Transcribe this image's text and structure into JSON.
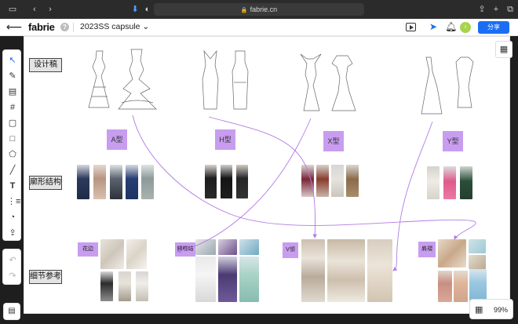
{
  "browser": {
    "url": "fabrie.cn"
  },
  "header": {
    "logo": "fabrie",
    "help": "?",
    "project_name": "2023SS capsule",
    "project_chevron": "⌄",
    "share_label": "分享",
    "avatar_text": "i"
  },
  "rows": {
    "design": "设计稿",
    "silhouette": "廓形结构",
    "details": "细节参考"
  },
  "types": [
    "A型",
    "H型",
    "X型",
    "Y型"
  ],
  "detail_tags": [
    "花边",
    "蝴蝶结",
    "V领",
    "肩褶"
  ],
  "zoom": "99%",
  "colors": {
    "accent": "#1b6ef3",
    "tag_purple": "#c89df0",
    "arrow_purple": "#b27be6"
  }
}
